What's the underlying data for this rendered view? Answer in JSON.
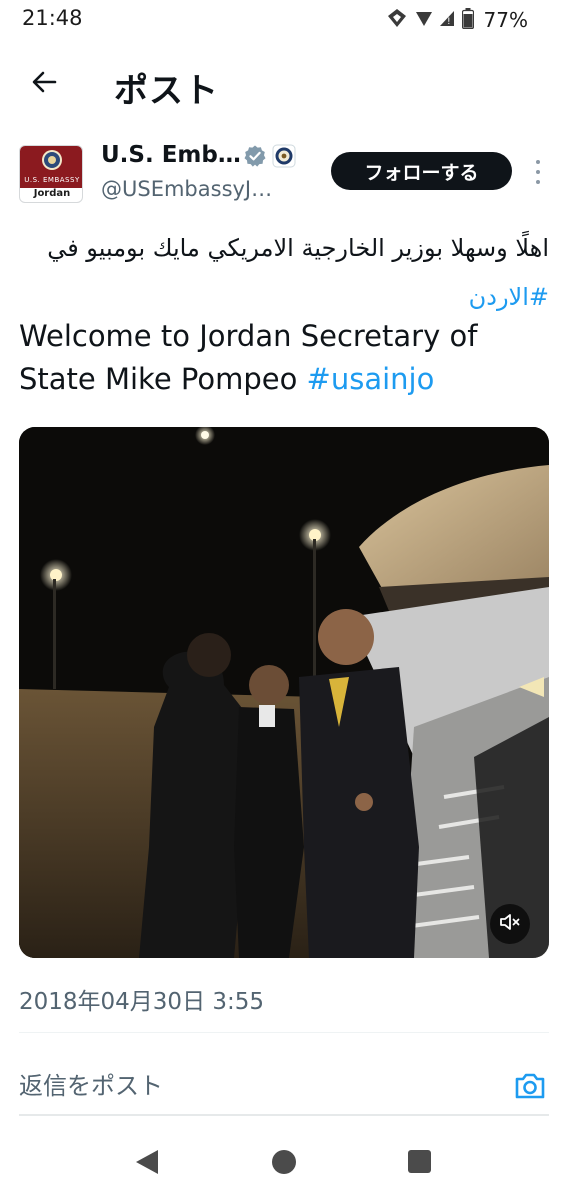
{
  "status_bar": {
    "time": "21:48",
    "battery_percent": "77%"
  },
  "header": {
    "title": "ポスト",
    "back_icon": "arrow-left-icon"
  },
  "post": {
    "author": {
      "display_name": "U.S. Emb…",
      "handle": "@USEmbassyJ…",
      "avatar_caption": "U.S. EMBASSY",
      "avatar_label": "Jordan",
      "verified_icon": "verified-badge-icon",
      "affiliation_icon": "state-department-seal-icon"
    },
    "follow_label": "フォローする",
    "arabic_text": "اهلًا وسهلا بوزير الخارجية الامريكي مايك بومبيو في",
    "arabic_hashtag": "#الاردن",
    "english_text": "Welcome to Jordan Secretary of State  Mike Pompeo",
    "english_hashtag": "#usainjo",
    "media": {
      "type": "video",
      "muted": true,
      "mute_icon": "speaker-muted-icon"
    },
    "timestamp": "2018年04月30日 3:55"
  },
  "reply": {
    "placeholder": "返信をポスト",
    "camera_icon": "camera-icon"
  },
  "colors": {
    "hashtag": "#1d9bf0",
    "follow_bg": "#0f1419",
    "muted_text": "#536471"
  }
}
